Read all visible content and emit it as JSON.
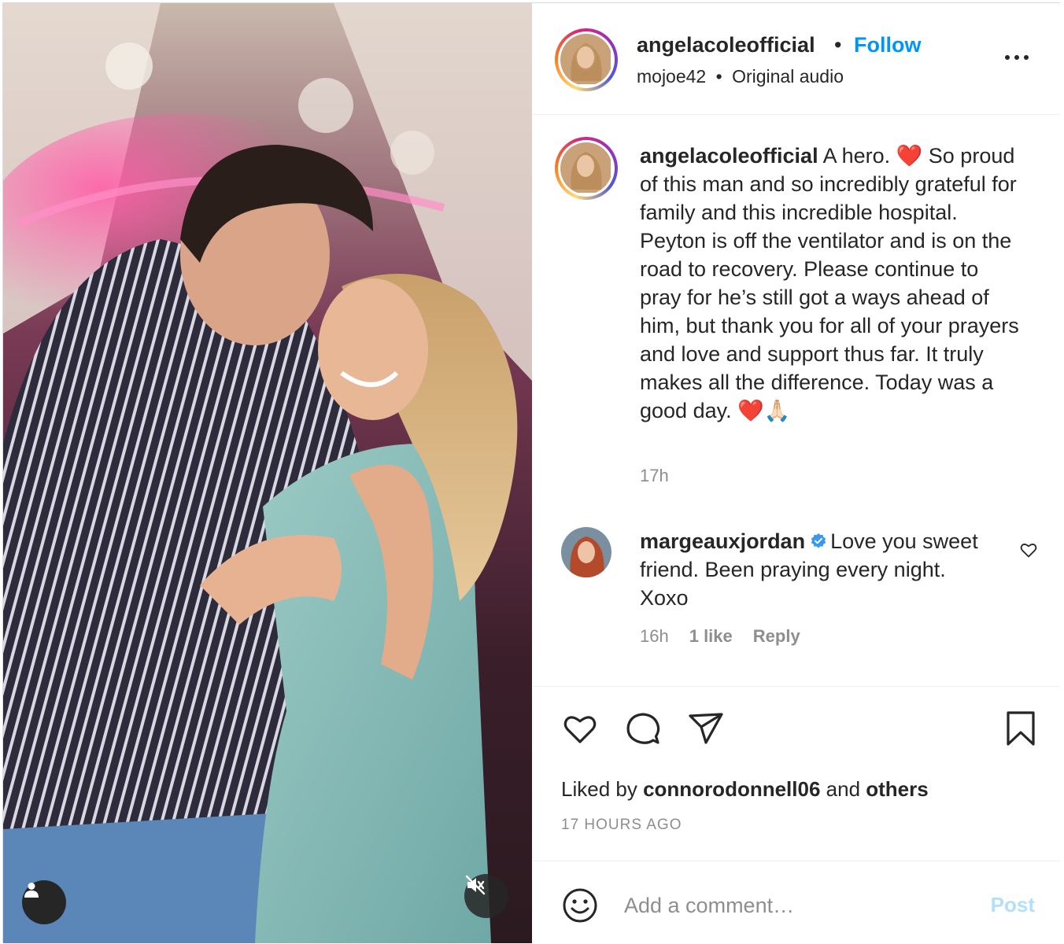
{
  "post": {
    "username": "angelacoleofficial",
    "separator": "•",
    "follow_label": "Follow",
    "audio_user": "mojoe42",
    "audio_separator": "•",
    "audio_label": "Original audio"
  },
  "caption": {
    "username": "angelacoleofficial",
    "text_1": " A hero. ",
    "emoji_1": "❤️",
    "text_2": " So proud of this man and so incredibly grateful for family and this incredible hospital. Peyton is off the ventilator and is on the road to recovery. Please continue to pray for he’s still got a ways ahead of him, but thank you for all of your prayers and love and support thus far. It truly makes all the difference. Today was a good day. ",
    "emoji_2": "❤️🙏🏻",
    "time": "17h"
  },
  "comment": {
    "username": "margeauxjordan",
    "text": "Love you sweet friend. Been praying every night. Xoxo",
    "time": "16h",
    "likes": "1 like",
    "reply_label": "Reply"
  },
  "likes": {
    "prefix": "Liked by ",
    "user": "connorodonnell06",
    "middle": " and ",
    "others": "others"
  },
  "timestamp": "17 HOURS AGO",
  "composer": {
    "placeholder": "Add a comment…",
    "post_label": "Post"
  },
  "icons": {
    "like": "heart-icon",
    "comment": "comment-bubble-icon",
    "share": "paper-plane-icon",
    "save": "bookmark-icon",
    "emoji": "smiley-icon",
    "more": "more-dots-icon",
    "user_tag": "user-tag-icon",
    "mute": "speaker-muted-icon",
    "verified": "verified-badge-icon"
  },
  "colors": {
    "accent": "#0095f6",
    "post_disabled": "#b2dffc",
    "muted_text": "#8e8e8e",
    "heart_emoji": "#e0245e"
  }
}
